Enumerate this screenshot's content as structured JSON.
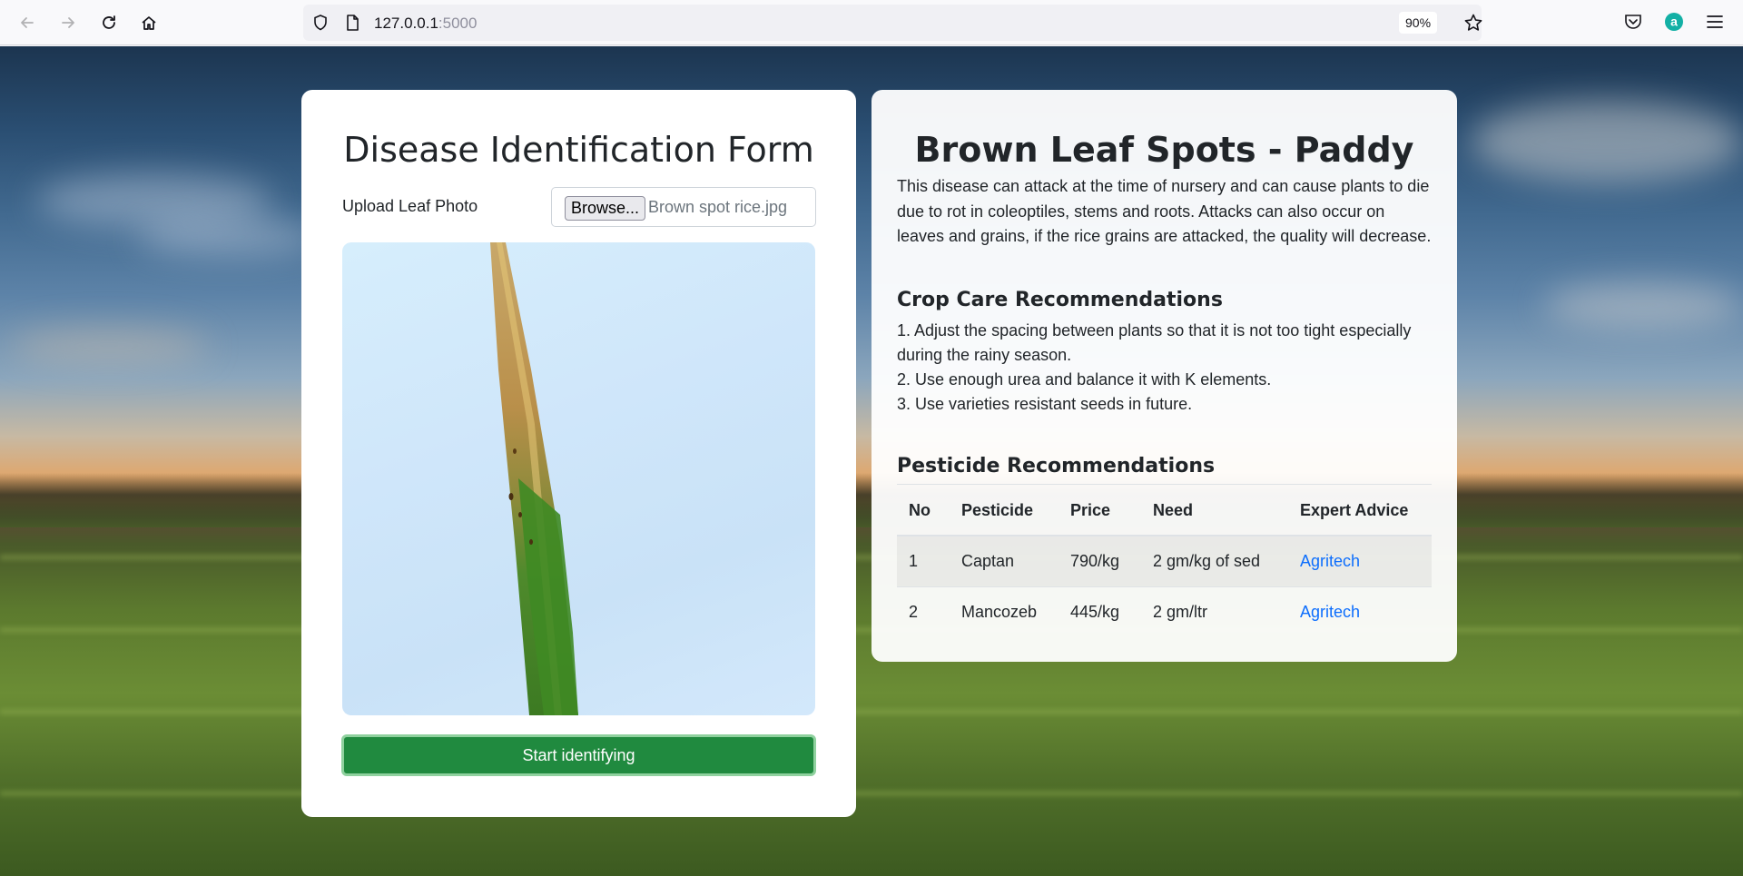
{
  "browser": {
    "url_host": "127.0.0.1",
    "url_port": ":5000",
    "zoom": "90%"
  },
  "form": {
    "title": "Disease Identification Form",
    "upload_label": "Upload Leaf Photo",
    "browse_label": "Browse...",
    "file_name": "Brown spot rice.jpg",
    "submit_label": "Start identifying"
  },
  "result": {
    "title": "Brown Leaf Spots - Paddy",
    "description": "This disease can attack at the time of nursery and can cause plants to die due to rot in coleoptiles, stems and roots. Attacks can also occur on leaves and grains, if the rice grains are attacked, the quality will decrease.",
    "care_title": "Crop Care Recommendations",
    "care_items": [
      "1. Adjust the spacing between plants so that it is not too tight especially during the rainy season.",
      "2. Use enough urea and balance it with K elements.",
      "3. Use varieties resistant seeds in future."
    ],
    "pesticide_title": "Pesticide Recommendations",
    "table": {
      "headers": [
        "No",
        "Pesticide",
        "Price",
        "Need",
        "Expert Advice"
      ],
      "rows": [
        [
          "1",
          "Captan",
          "790/kg",
          "2 gm/kg of sed",
          "Agritech"
        ],
        [
          "2",
          "Mancozeb",
          "445/kg",
          "2 gm/ltr",
          "Agritech"
        ]
      ]
    }
  },
  "colors": {
    "submit_button": "#208a3f",
    "link": "#0d6efd"
  }
}
